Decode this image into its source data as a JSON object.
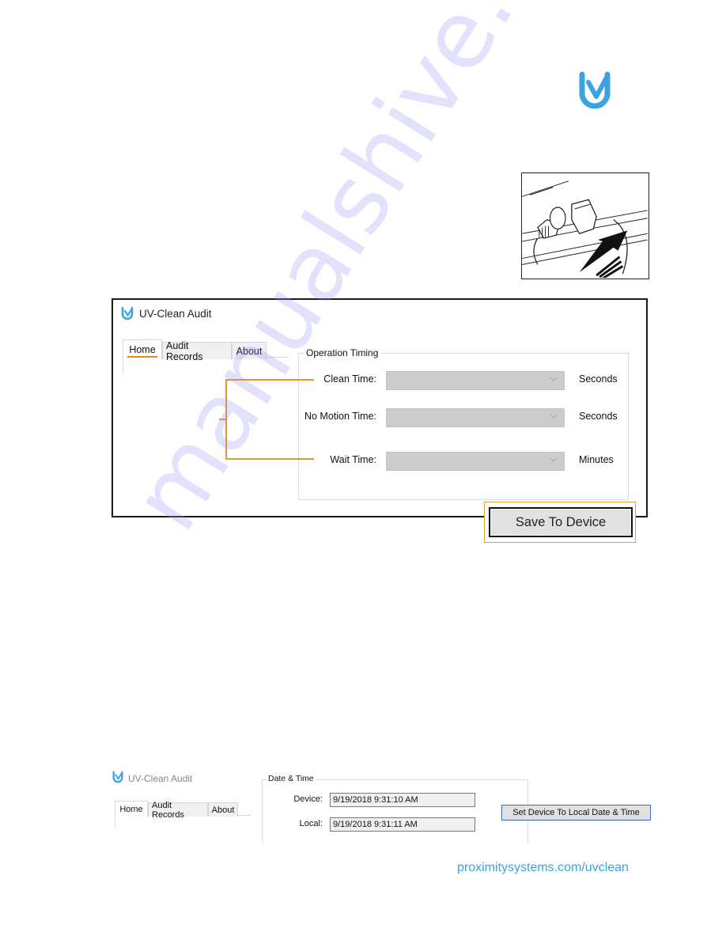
{
  "brand": {
    "logo_icon": "uv-check-logo-icon",
    "color": "#3aa3e0"
  },
  "illustration": {
    "description": "device-connector-insertion-diagram",
    "icon": "arrow-up-icon"
  },
  "app_window": {
    "title": "UV-Clean Audit",
    "app_icon": "uv-check-logo-icon",
    "tabs": [
      {
        "label": "Home",
        "active": true
      },
      {
        "label": "Audit Records",
        "active": false
      },
      {
        "label": "About",
        "active": false
      }
    ],
    "operation_timing": {
      "group_label": "Operation Timing",
      "fields": [
        {
          "label": "Clean Time:",
          "value": "",
          "unit": "Seconds"
        },
        {
          "label": "No Motion Time:",
          "value": "",
          "unit": "Seconds"
        },
        {
          "label": "Wait Time:",
          "value": "",
          "unit": "Minutes"
        }
      ]
    },
    "save_button_label": "Save To Device",
    "highlight_color": "#e8962a"
  },
  "datetime_window": {
    "title": "UV-Clean Audit",
    "app_icon": "uv-check-logo-icon",
    "tabs": [
      {
        "label": "Home",
        "active": true
      },
      {
        "label": "Audit Records",
        "active": false
      },
      {
        "label": "About",
        "active": false
      }
    ],
    "group_label": "Date & Time",
    "device_label": "Device:",
    "device_value": "9/19/2018 9:31:10 AM",
    "local_label": "Local:",
    "local_value": "9/19/2018 9:31:11 AM",
    "set_button_label": "Set Device To Local Date & Time"
  },
  "footer": {
    "link_text": "proximitysystems.com/uvclean"
  },
  "watermark": {
    "text": "manualshive.com"
  }
}
